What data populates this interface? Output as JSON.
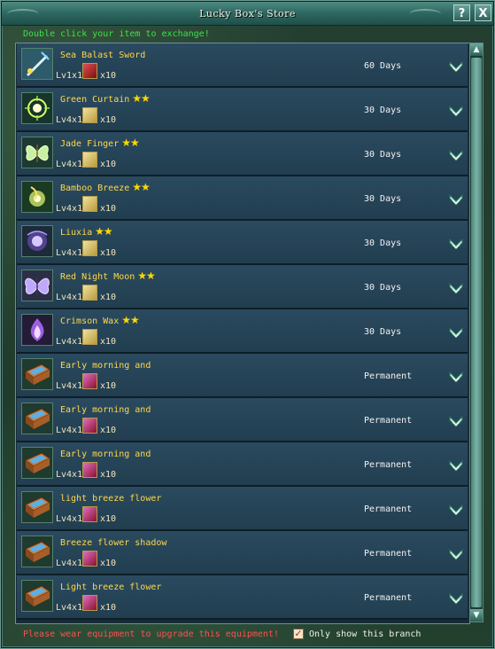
{
  "window": {
    "title": "Lucky Box's Store",
    "help_label": "?",
    "close_label": "X"
  },
  "hint": "Double click your item to exchange!",
  "items": [
    {
      "name": "Sea Balast Sword",
      "stars": "",
      "level": "Lv1x1",
      "material": "red",
      "qty": "x10",
      "duration": "60 Days",
      "icon": "sword-icon"
    },
    {
      "name": "Green Curtain",
      "stars": "★★",
      "level": "Lv4x1",
      "material": "scroll",
      "qty": "x10",
      "duration": "30 Days",
      "icon": "green-orb-icon"
    },
    {
      "name": "Jade Finger",
      "stars": "★★",
      "level": "Lv4x1",
      "material": "scroll",
      "qty": "x10",
      "duration": "30 Days",
      "icon": "butterfly-icon"
    },
    {
      "name": "Bamboo Breeze",
      "stars": "★★",
      "level": "Lv4x1",
      "material": "scroll",
      "qty": "x10",
      "duration": "30 Days",
      "icon": "spark-icon"
    },
    {
      "name": "Liuxia",
      "stars": "★★",
      "level": "Lv4x1",
      "material": "scroll",
      "qty": "x10",
      "duration": "30 Days",
      "icon": "purple-orb-icon"
    },
    {
      "name": "Red Night Moon",
      "stars": "★★",
      "level": "Lv4x1",
      "material": "scroll",
      "qty": "x10",
      "duration": "30 Days",
      "icon": "moth-icon"
    },
    {
      "name": "Crimson Wax",
      "stars": "★★",
      "level": "Lv4x1",
      "material": "scroll",
      "qty": "x10",
      "duration": "30 Days",
      "icon": "flame-icon"
    },
    {
      "name": "Early morning and",
      "stars": "",
      "level": "Lv4x1",
      "material": "gem",
      "qty": "x10",
      "duration": "Permanent",
      "icon": "box-icon"
    },
    {
      "name": "Early morning and",
      "stars": "",
      "level": "Lv4x1",
      "material": "gem",
      "qty": "x10",
      "duration": "Permanent",
      "icon": "box-icon"
    },
    {
      "name": "Early morning and",
      "stars": "",
      "level": "Lv4x1",
      "material": "gem",
      "qty": "x10",
      "duration": "Permanent",
      "icon": "box-icon"
    },
    {
      "name": "light breeze flower",
      "stars": "",
      "level": "Lv4x1",
      "material": "gem",
      "qty": "x10",
      "duration": "Permanent",
      "icon": "box-icon"
    },
    {
      "name": "Breeze flower shadow",
      "stars": "",
      "level": "Lv4x1",
      "material": "gem",
      "qty": "x10",
      "duration": "Permanent",
      "icon": "box-icon"
    },
    {
      "name": "Light breeze flower",
      "stars": "",
      "level": "Lv4x1",
      "material": "gem",
      "qty": "x10",
      "duration": "Permanent",
      "icon": "box-icon"
    }
  ],
  "footer": {
    "warning": "Please wear equipment to upgrade this equipment!",
    "checkbox_checked": true,
    "checkbox_mark": "✓",
    "checkbox_label": "Only show this branch"
  },
  "scrollbar": {
    "up": "▲",
    "down": "▼"
  }
}
